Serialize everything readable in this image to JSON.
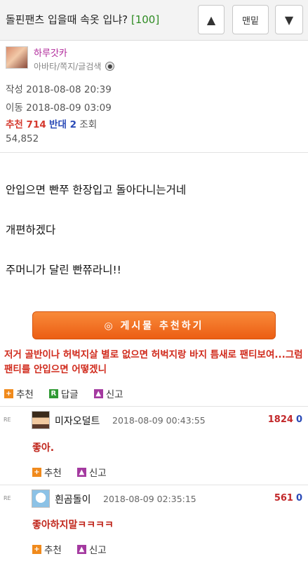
{
  "header": {
    "title": "돌핀팬츠 입을때 속옷 입냐?",
    "count": "[100]",
    "up_label": "▲",
    "bottom_label": "맨밑",
    "down_label": "▼"
  },
  "author": {
    "nickname": "하루갓카",
    "links": "아바타/쪽지/글검색",
    "created_label": "작성",
    "created": "2018-08-08 20:39",
    "moved_label": "이동",
    "moved": "2018-08-09 03:09",
    "recommend_label": "추천",
    "recommend": "714",
    "opposite_label": "반대",
    "opposite": "2",
    "views_label": "조회",
    "views": "54,852"
  },
  "post": {
    "lines": [
      "안입으면 빤쭈 한장입고 돌아다니는거네",
      "개편하겠다",
      "주머니가 달린 빤쮸라니!!"
    ]
  },
  "recommend_button": "◎ 게시물  추천하기",
  "best_reply": "저거 골반이나 허벅지살 별로 없으면 허벅지랑 바지 틈새로 팬티보여...그럼 팬티를 안입으면 어떻겠니",
  "actions": {
    "recommend": "추천",
    "reply": "답글",
    "report": "신고"
  },
  "comments": [
    {
      "name": "미자오덜트",
      "date": "2018-08-09 00:43:55",
      "score": "1824",
      "opp": "0",
      "text": "좋아."
    },
    {
      "name": "흰곰돌이",
      "date": "2018-08-09 02:35:15",
      "score": "561",
      "opp": "0",
      "text": "좋아하지말ㅋㅋㅋㅋ"
    }
  ],
  "re_label": "RE"
}
